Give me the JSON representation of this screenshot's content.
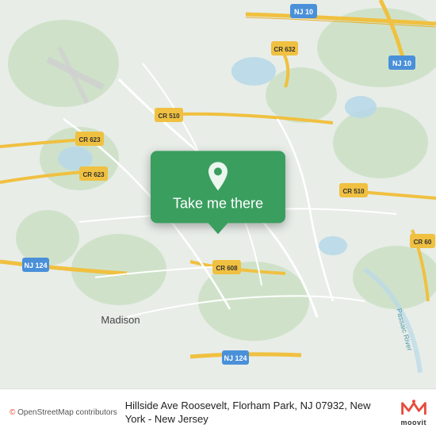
{
  "map": {
    "popup_label": "Take me there",
    "address": "Hillside Ave Roosevelt, Florham Park, NJ 07932, New York - New Jersey",
    "osm_attribution": "© OpenStreetMap contributors",
    "moovit_label": "moovit",
    "road_labels": [
      "NJ 10",
      "NJ 10",
      "CR 632",
      "CR 510",
      "CR 623",
      "CR 623",
      "NJ 124",
      "CR 608",
      "NJ 124",
      "CR 60",
      "CR 510"
    ],
    "place_label": "Madison"
  }
}
